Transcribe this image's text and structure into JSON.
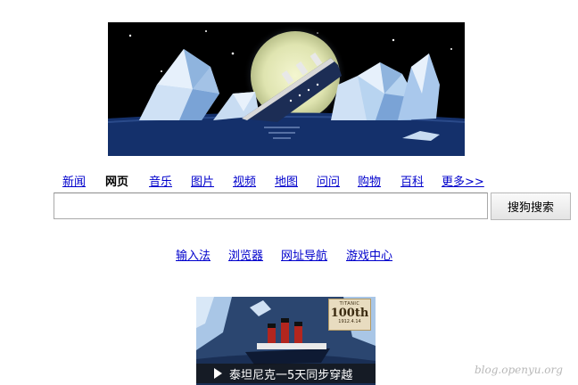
{
  "nav": {
    "items": [
      "新闻",
      "网页",
      "音乐",
      "图片",
      "视频",
      "地图",
      "问问",
      "购物",
      "百科",
      "更多>>"
    ],
    "current_index": 1
  },
  "search": {
    "value": "",
    "button_label": "搜狗搜索"
  },
  "bottom_links": [
    "输入法",
    "浏览器",
    "网址导航",
    "游戏中心"
  ],
  "promo": {
    "caption": "泰坦尼克一5天同步穿越",
    "badge": {
      "title": "TITANIC",
      "number": "100th",
      "date": "1912.4.14"
    }
  },
  "watermark": "blog.openyu.org",
  "colors": {
    "link": "#0000cc",
    "logo_bg": "#000000",
    "sea": "#14306b",
    "moon": "#e8ebb8"
  }
}
